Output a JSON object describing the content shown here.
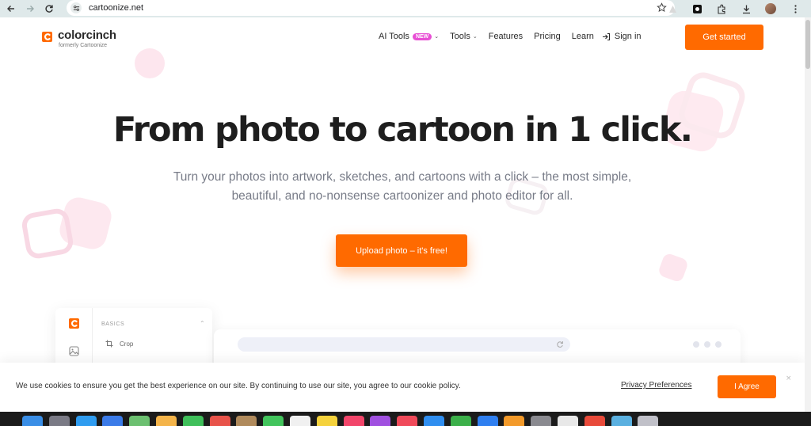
{
  "browser": {
    "url": "cartoonize.net"
  },
  "header": {
    "logo_name": "colorcinch",
    "logo_sub": "formerly Cartoonize",
    "nav": {
      "ai_tools": "AI Tools",
      "new_badge": "NEW",
      "tools": "Tools",
      "features": "Features",
      "pricing": "Pricing",
      "learn": "Learn",
      "signin": "Sign in"
    },
    "cta": "Get started"
  },
  "hero": {
    "title": "From photo to cartoon in 1 click.",
    "subtitle": "Turn your photos into artwork, sketches, and cartoons with a click – the most simple, beautiful, and no-nonsense cartoonizer and photo editor for all.",
    "upload": "Upload photo – it's free!"
  },
  "editor": {
    "section": "BASICS",
    "crop": "Crop"
  },
  "cookie": {
    "text": "We use cookies to ensure you get the best experience on our site. By continuing to use our site, you agree to our cookie policy.",
    "preferences": "Privacy Preferences",
    "agree": "I Agree",
    "close": "×"
  },
  "colors": {
    "accent": "#ff6a00",
    "badge": "#e84fd4",
    "chrome": "#dfe9ea"
  },
  "dock": {
    "apps": [
      "finder",
      "launchpad",
      "safari",
      "mail",
      "maps",
      "photos",
      "facetime",
      "calendar",
      "contacts",
      "messages",
      "reminders",
      "notes",
      "music",
      "podcasts",
      "news",
      "app-store",
      "numbers",
      "keynote",
      "pages",
      "system-settings",
      "textedit",
      "chrome",
      "preview",
      "trash"
    ]
  }
}
